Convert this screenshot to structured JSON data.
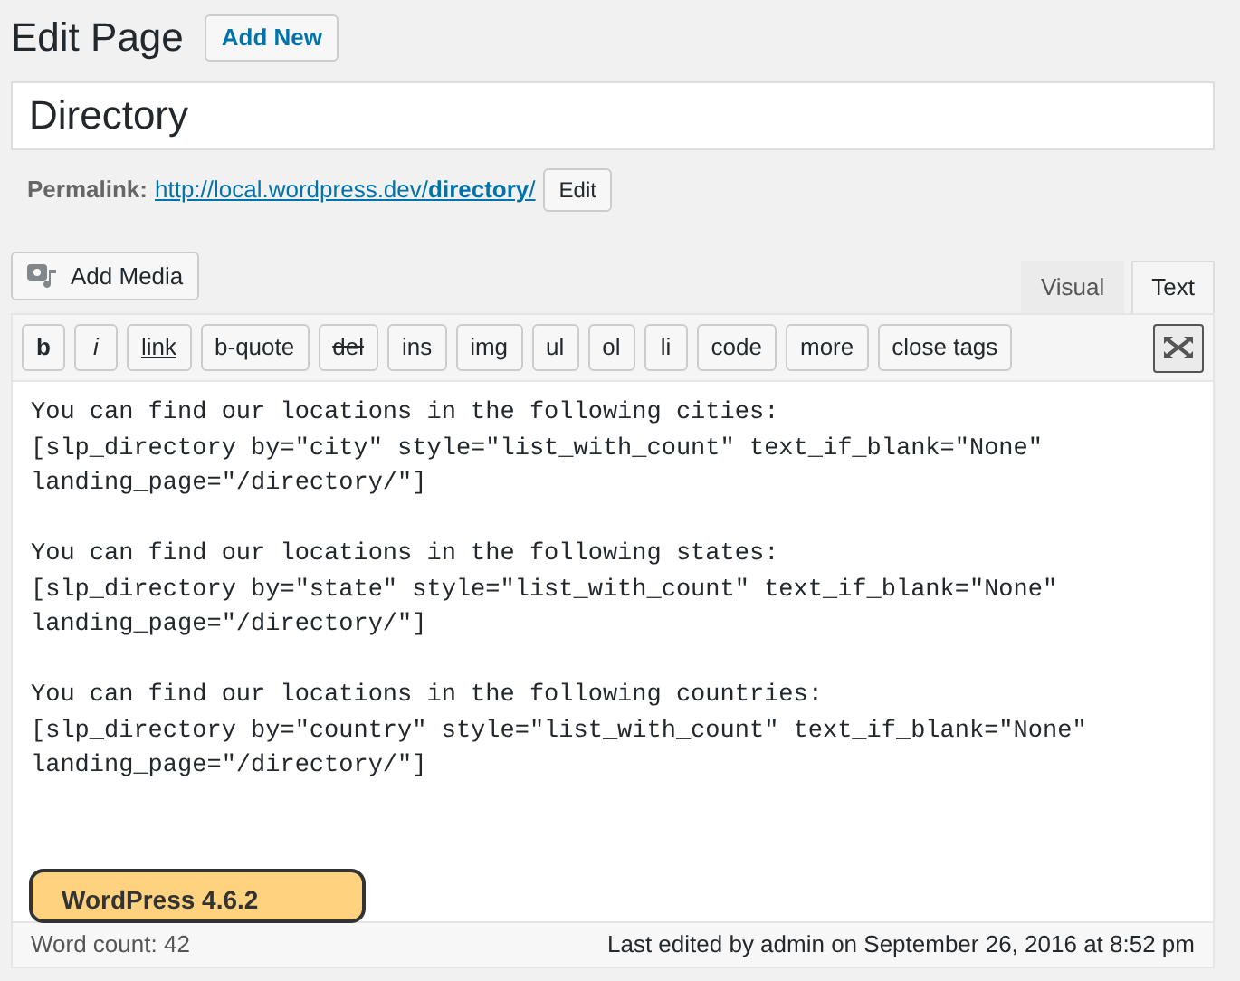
{
  "header": {
    "title": "Edit Page",
    "add_new": "Add New"
  },
  "post_title": {
    "value": "Directory"
  },
  "permalink": {
    "label": "Permalink:",
    "url": "http://local.wordpress.dev/**directory**/",
    "edit": "Edit"
  },
  "add_media": "Add Media",
  "editor_tabs": [
    {
      "label": "Visual",
      "selected": false
    },
    {
      "label": "Text",
      "selected": true
    }
  ],
  "toolbar": [
    {
      "label": "b",
      "kind": "bold"
    },
    {
      "label": "i",
      "kind": "italic"
    },
    {
      "label": "link",
      "kind": "underline"
    },
    {
      "label": "b-quote",
      "kind": "plain"
    },
    {
      "label": "del",
      "kind": "strike"
    },
    {
      "label": "ins",
      "kind": "plain"
    },
    {
      "label": "img",
      "kind": "plain"
    },
    {
      "label": "ul",
      "kind": "plain"
    },
    {
      "label": "ol",
      "kind": "plain"
    },
    {
      "label": "li",
      "kind": "plain"
    },
    {
      "label": "code",
      "kind": "plain"
    },
    {
      "label": "more",
      "kind": "plain"
    },
    {
      "label": "close tags",
      "kind": "plain"
    }
  ],
  "content": [
    {
      "lines": [
        "You can find our locations in the following cities:",
        "[slp_directory by=\"city\" style=\"list_with_count\" text_if_blank=\"None\"",
        "landing_page=\"/directory/\"]"
      ]
    },
    {
      "lines": [
        "You can find our locations in the following states:",
        "[slp_directory by=\"state\" style=\"list_with_count\" text_if_blank=\"None\"",
        "landing_page=\"/directory/\"]"
      ]
    },
    {
      "lines": [
        "You can find our locations in the following countries:",
        "[slp_directory by=\"country\" style=\"list_with_count\" text_if_blank=\"None\"",
        "landing_page=\"/directory/\"]"
      ]
    }
  ],
  "status_bar": {
    "word_count": "Word count: 42",
    "last_edited": "Last edited by admin on September 26, 2016 at 8:52 pm"
  },
  "version_badge": "WordPress 4.6.2"
}
